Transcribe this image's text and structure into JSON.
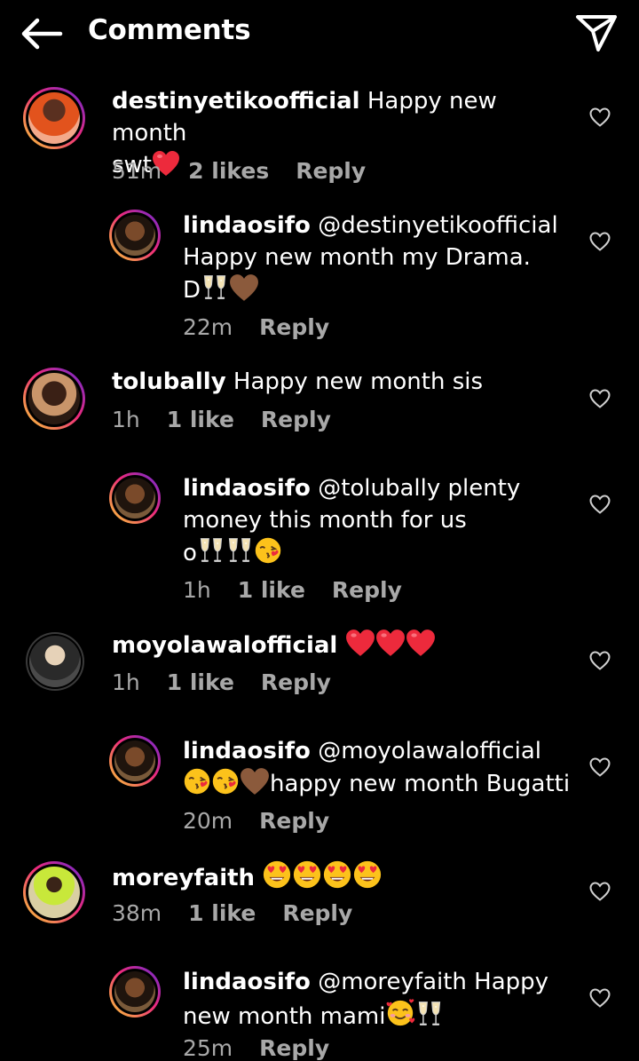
{
  "header": {
    "title": "Comments",
    "back_icon": "arrow-left-icon",
    "share_icon": "paper-plane-icon"
  },
  "colors": {
    "background": "#000000",
    "text": "#ffffff",
    "secondary": "#a8a8a8",
    "heart": "#ed2a3c",
    "brown_heart": "#8b5a3c"
  },
  "comments": [
    {
      "user": "destinyetikoofficial",
      "text": "Happy new month",
      "text2": "swt",
      "time": "51m",
      "likes": "2 likes",
      "reply": "Reply"
    },
    {
      "user": "lindaosifo",
      "mention": "@destinyetikoofficial",
      "text2": "Happy new month my Drama.",
      "text3": "D",
      "time": "22m",
      "reply": "Reply"
    },
    {
      "user": "tolubally",
      "text": "Happy new month sis",
      "time": "1h",
      "likes": "1 like",
      "reply": "Reply"
    },
    {
      "user": "lindaosifo",
      "mention": "@tolubally",
      "text": "plenty",
      "text2": "money this month for us",
      "text3": "o",
      "time": "1h",
      "likes": "1 like",
      "reply": "Reply"
    },
    {
      "user": "moyolawalofficial",
      "time": "1h",
      "likes": "1 like",
      "reply": "Reply"
    },
    {
      "user": "lindaosifo",
      "mention": "@moyolawalofficial",
      "text2": "happy new month Bugatti",
      "time": "20m",
      "reply": "Reply"
    },
    {
      "user": "moreyfaith",
      "time": "38m",
      "likes": "1 like",
      "reply": "Reply"
    },
    {
      "user": "lindaosifo",
      "mention": "@moreyfaith",
      "text": "Happy",
      "text2": "new month mami",
      "time": "25m",
      "reply": "Reply"
    }
  ]
}
